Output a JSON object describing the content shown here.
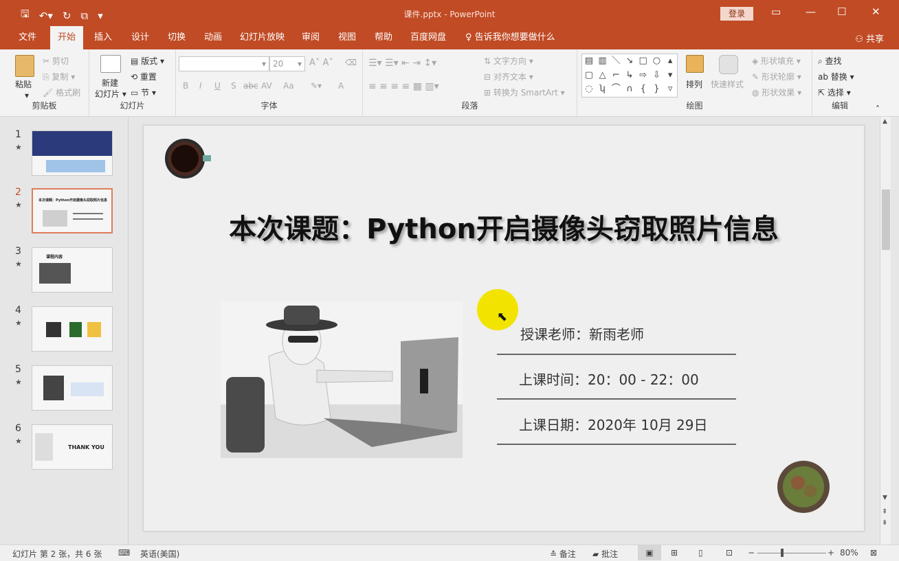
{
  "window": {
    "title": "课件.pptx - PowerPoint",
    "login": "登录",
    "share": "共享"
  },
  "tabs": [
    "文件",
    "开始",
    "插入",
    "设计",
    "切换",
    "动画",
    "幻灯片放映",
    "审阅",
    "视图",
    "帮助",
    "百度网盘"
  ],
  "tell_me": "告诉我你想要做什么",
  "ribbon": {
    "clipboard": {
      "paste": "粘贴",
      "cut": "剪切",
      "copy": "复制",
      "format_painter": "格式刷",
      "label": "剪贴板"
    },
    "slides": {
      "new_slide_line1": "新建",
      "new_slide_line2": "幻灯片",
      "layout": "版式",
      "reset": "重置",
      "section": "节",
      "label": "幻灯片"
    },
    "font": {
      "size": "20",
      "bold": "B",
      "italic": "I",
      "underline": "U",
      "shadow": "S",
      "strike": "abc",
      "spacing": "AV",
      "case": "Aa",
      "color": "A",
      "label": "字体"
    },
    "paragraph": {
      "text_direction": "文字方向",
      "align_text": "对齐文本",
      "smartart": "转换为 SmartArt",
      "label": "段落"
    },
    "drawing": {
      "arrange": "排列",
      "quick_styles": "快速样式",
      "shape_fill": "形状填充",
      "shape_outline": "形状轮廓",
      "shape_effects": "形状效果",
      "label": "绘图"
    },
    "editing": {
      "find": "查找",
      "replace": "替换",
      "select": "选择",
      "label": "编辑"
    }
  },
  "thumbnails": [
    {
      "num": "1",
      "caption": ""
    },
    {
      "num": "2",
      "caption": "本次课题：Python开启摄像头窃取照片信息"
    },
    {
      "num": "3",
      "caption": "课程内容"
    },
    {
      "num": "4",
      "caption": ""
    },
    {
      "num": "5",
      "caption": ""
    },
    {
      "num": "6",
      "caption": "THANK YOU"
    }
  ],
  "slide": {
    "title": "本次课题：Python开启摄像头窃取照片信息",
    "teacher": "授课老师：新雨老师",
    "time": "上课时间：20：00 - 22：00",
    "date": "上课日期：2020年 10月 29日"
  },
  "status": {
    "slide_info": "幻灯片 第 2 张，共 6 张",
    "language": "英语(美国)",
    "notes": "备注",
    "comments": "批注",
    "zoom": "80%"
  },
  "colors": {
    "accent": "#c04b25",
    "cursor_highlight": "#f2e400"
  }
}
